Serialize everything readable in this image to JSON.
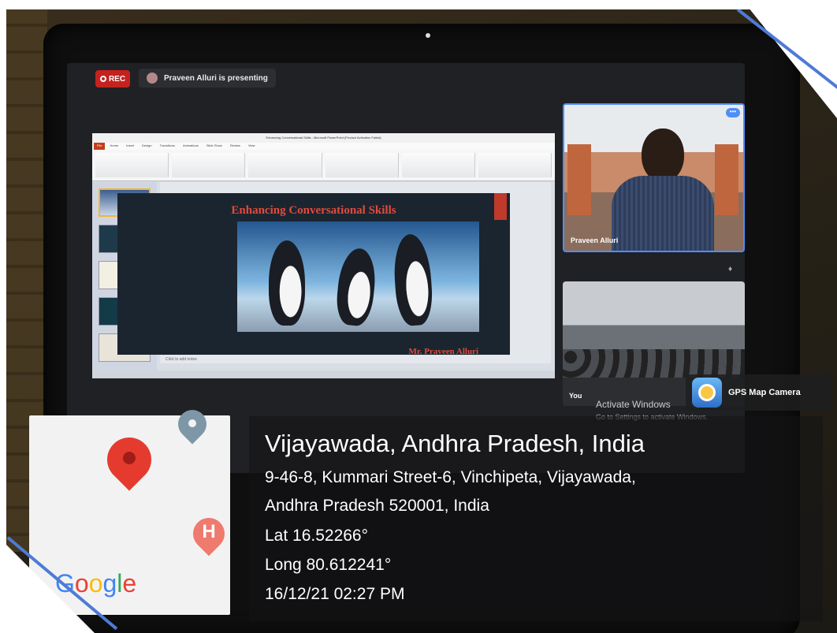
{
  "meet": {
    "rec_label": "REC",
    "presenting_text": "Praveen Alluri is presenting",
    "tiles": [
      {
        "name": "Praveen Alluri"
      },
      {
        "name": "You"
      }
    ],
    "more_glyph": "•••"
  },
  "slide": {
    "title": "Enhancing Conversational Skills",
    "author": "Mr. Praveen Alluri",
    "notes_placeholder": "Click to add notes"
  },
  "ppt": {
    "window_title": "Enhancing Conversational Skills - Microsoft PowerPoint (Product Activation Failed)",
    "tabs": [
      "File",
      "Home",
      "Insert",
      "Design",
      "Transitions",
      "Animations",
      "Slide Show",
      "Review",
      "View"
    ]
  },
  "windows_watermark": {
    "title": "Activate Windows",
    "subtitle": "Go to Settings to activate Windows."
  },
  "gps": {
    "app_name": "GPS Map Camera",
    "location_title": "Vijayawada, Andhra Pradesh, India",
    "address_line1": "9-46-8, Kummari Street-6, Vinchipeta, Vijayawada,",
    "address_line2": "Andhra Pradesh 520001, India",
    "lat": "Lat 16.52266°",
    "long": "Long 80.612241°",
    "datetime": "16/12/21 02:27 PM",
    "map_logo": "Google",
    "map_poi_letter": "H"
  },
  "colors": {
    "rec": "#c5221f",
    "active_speaker_border": "#4f8ef7",
    "slide_title": "#e34a3a",
    "frame_accent": "#4d7bd6"
  }
}
